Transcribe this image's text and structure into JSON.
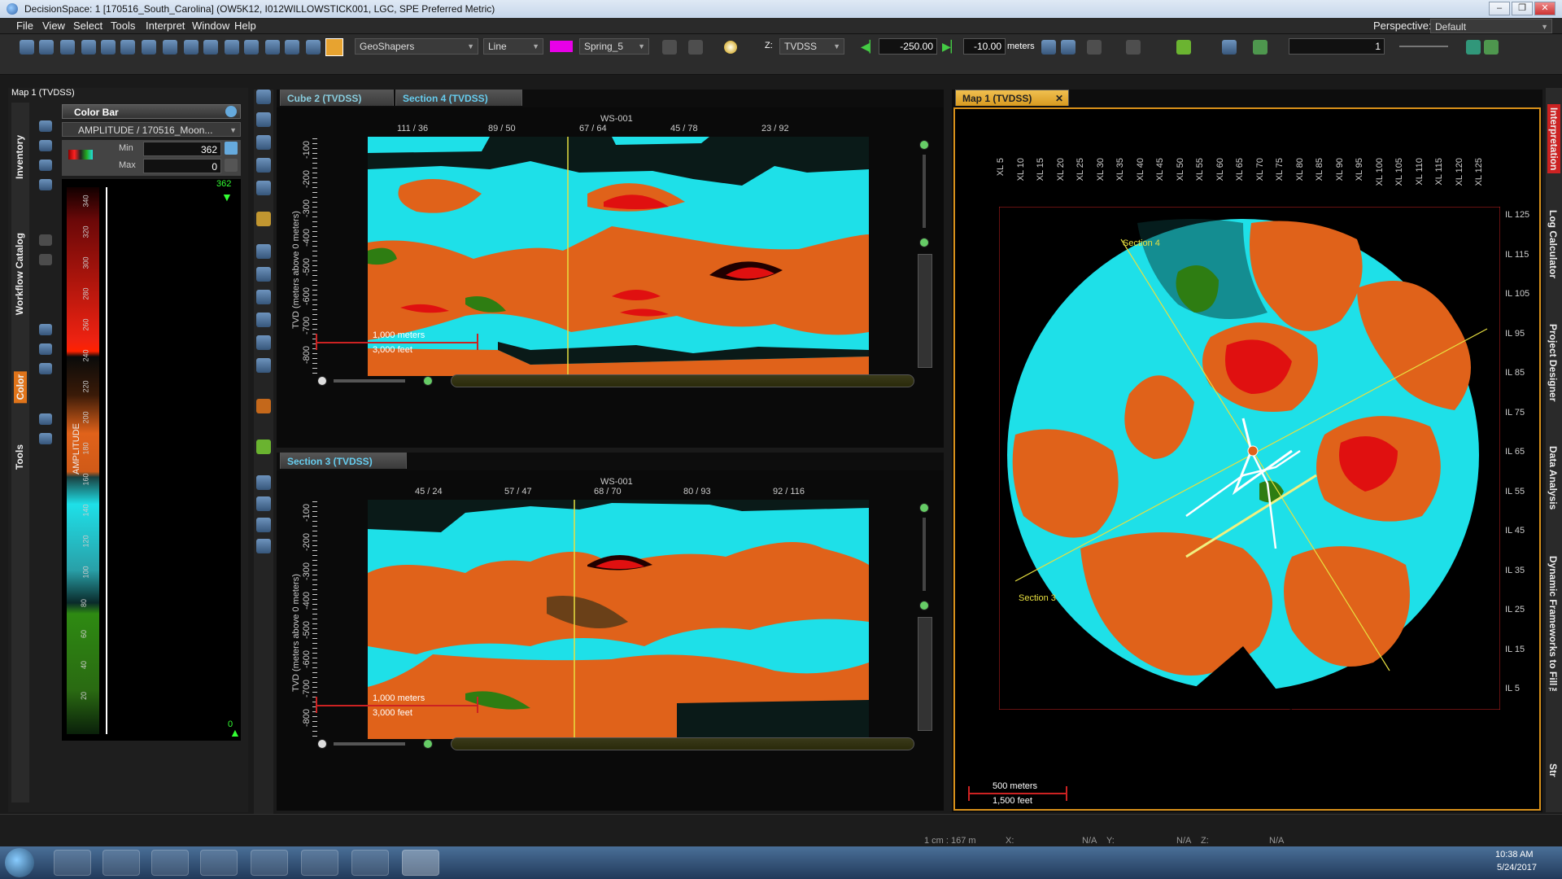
{
  "window": {
    "title": "DecisionSpace: 1 [170516_South_Carolina] (OW5K12, I012WILLOWSTICK001, LGC, SPE Preferred Metric)",
    "controls": [
      "–",
      "❐",
      "✕"
    ]
  },
  "menu": {
    "items": [
      "File",
      "View",
      "Select",
      "Tools",
      "Interpret",
      "Window",
      "Help"
    ],
    "perspective_label": "Perspective:",
    "perspective_value": "Default"
  },
  "toolbar": {
    "tool_select": "GeoShapers",
    "mode_select": "Line",
    "color_swatch": "#e800e8",
    "colormap_select": "Spring_5",
    "z_label": "Z:",
    "z_domain": "TVDSS",
    "z_start": "-250.00",
    "z_step": "-10.00",
    "z_units": "meters",
    "counter": "1"
  },
  "left_panel": {
    "title": "Map 1 (TVDSS)",
    "side_tabs": [
      "Inventory",
      "Workflow Catalog",
      "Color",
      "Tools"
    ],
    "colorbar_title": "Color Bar",
    "attribute": "AMPLITUDE / 170516_Moon...",
    "min_label": "Min",
    "min_value": "362",
    "max_label": "Max",
    "max_value": "0",
    "top_value": "362",
    "bottom_value": "0",
    "axis_label": "AMPLITUDE",
    "scale_ticks": [
      "340",
      "320",
      "300",
      "280",
      "260",
      "240",
      "220",
      "200",
      "180",
      "160",
      "140",
      "120",
      "100",
      "80",
      "60",
      "40",
      "20"
    ]
  },
  "top_view": {
    "tabs": [
      "Cube 2 (TVDSS)",
      "Section 4 (TVDSS)"
    ],
    "well": "WS-001",
    "x_ticks": [
      "111 / 36",
      "89 / 50",
      "67 / 64",
      "45 / 78",
      "23 / 92"
    ],
    "y_label": "TVD (meters above 0 meters)",
    "y_ticks": [
      "-100",
      "-200",
      "-300",
      "-400",
      "-500",
      "-600",
      "-700",
      "-800"
    ],
    "scale_m": "1,000 meters",
    "scale_ft": "3,000 feet"
  },
  "bottom_view": {
    "tab": "Section 3 (TVDSS)",
    "well": "WS-001",
    "x_ticks": [
      "45 / 24",
      "57 / 47",
      "68 / 70",
      "80 / 93",
      "92 / 116"
    ],
    "y_label": "TVD (meters above 0 meters)",
    "y_ticks": [
      "-100",
      "-200",
      "-300",
      "-400",
      "-500",
      "-600",
      "-700",
      "-800"
    ],
    "scale_m": "1,000 meters",
    "scale_ft": "3,000 feet"
  },
  "map_view": {
    "tab": "Map 1 (TVDSS)",
    "xl_ticks": [
      "XL 5",
      "XL 10",
      "XL 15",
      "XL 20",
      "XL 25",
      "XL 30",
      "XL 35",
      "XL 40",
      "XL 45",
      "XL 50",
      "XL 55",
      "XL 60",
      "XL 65",
      "XL 70",
      "XL 75",
      "XL 80",
      "XL 85",
      "XL 90",
      "XL 95",
      "XL 100",
      "XL 105",
      "XL 110",
      "XL 115",
      "XL 120",
      "XL 125"
    ],
    "il_ticks": [
      "IL 125",
      "IL 115",
      "IL 105",
      "IL 95",
      "IL 85",
      "IL 75",
      "IL 65",
      "IL 55",
      "IL 45",
      "IL 35",
      "IL 25",
      "IL 15",
      "IL 5"
    ],
    "section4_label": "Section 4",
    "section3_label": "Section 3",
    "scale_m": "500 meters",
    "scale_ft": "1,500 feet"
  },
  "right_tabs": [
    "Interpretation",
    "Log Calculator",
    "Project Designer",
    "Data Analysis",
    "Dynamic Frameworks to Fill™",
    "Str"
  ],
  "status": {
    "text1": "1 cm : 167 m",
    "text2": "X:",
    "text3": "N/A",
    "text4": "Y:",
    "text5": "N/A",
    "text6": "Z:",
    "text7": "N/A"
  },
  "taskbar": {
    "apps": [
      "start-orb-icon",
      "ie-icon",
      "explorer-icon",
      "media-player-icon",
      "chrome-icon",
      "tweaker-icon",
      "notes-icon",
      "paint-icon",
      "decisionspace-icon"
    ],
    "time": "10:38 AM",
    "date": "5/24/2017"
  },
  "colors": {
    "cyan": "#1ee0e8",
    "orange": "#e0621a",
    "red": "#e01010",
    "green": "#2e7d12",
    "accent": "#f0c050"
  }
}
